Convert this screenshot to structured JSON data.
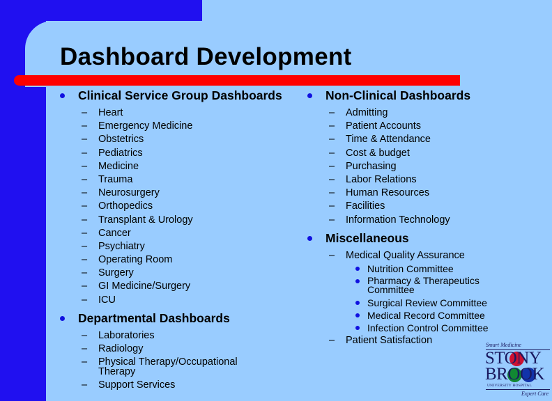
{
  "slide": {
    "title": "Dashboard Development",
    "colors": {
      "background": "#99CCFF",
      "frame_blue": "#2010F0",
      "accent_red": "#FF0000",
      "bullet_blue": "#1010E0"
    },
    "left_column": [
      {
        "heading": "Clinical Service Group Dashboards",
        "items": [
          "Heart",
          "Emergency Medicine",
          "Obstetrics",
          "Pediatrics",
          "Medicine",
          "Trauma",
          "Neurosurgery",
          "Orthopedics",
          "Transplant & Urology",
          "Cancer",
          "Psychiatry",
          "Operating Room",
          "Surgery",
          "GI Medicine/Surgery",
          "ICU"
        ]
      },
      {
        "heading": "Departmental Dashboards",
        "items": [
          "Laboratories",
          "Radiology",
          "Physical Therapy/Occupational Therapy",
          "Support Services"
        ]
      }
    ],
    "right_column": [
      {
        "heading": "Non-Clinical Dashboards",
        "items": [
          "Admitting",
          "Patient Accounts",
          "Time & Attendance",
          "Cost & budget",
          "Purchasing",
          "Labor Relations",
          "Human Resources",
          "Facilities",
          "Information Technology"
        ]
      },
      {
        "heading": "Miscellaneous",
        "items": [
          {
            "label": "Medical Quality Assurance",
            "subitems": [
              "Nutrition Committee",
              "Pharmacy & Therapeutics Committee",
              "Surgical Review Committee",
              "Medical Record Committee",
              "Infection Control Committee"
            ]
          },
          {
            "label": "Patient Satisfaction"
          }
        ]
      }
    ],
    "logo": {
      "tagline_top": "Smart Medicine",
      "word1": "STONY",
      "word2": "BROOK",
      "subtitle": "UNIVERSITY HOSPITAL",
      "tagline_bottom": "Expert Care"
    }
  }
}
